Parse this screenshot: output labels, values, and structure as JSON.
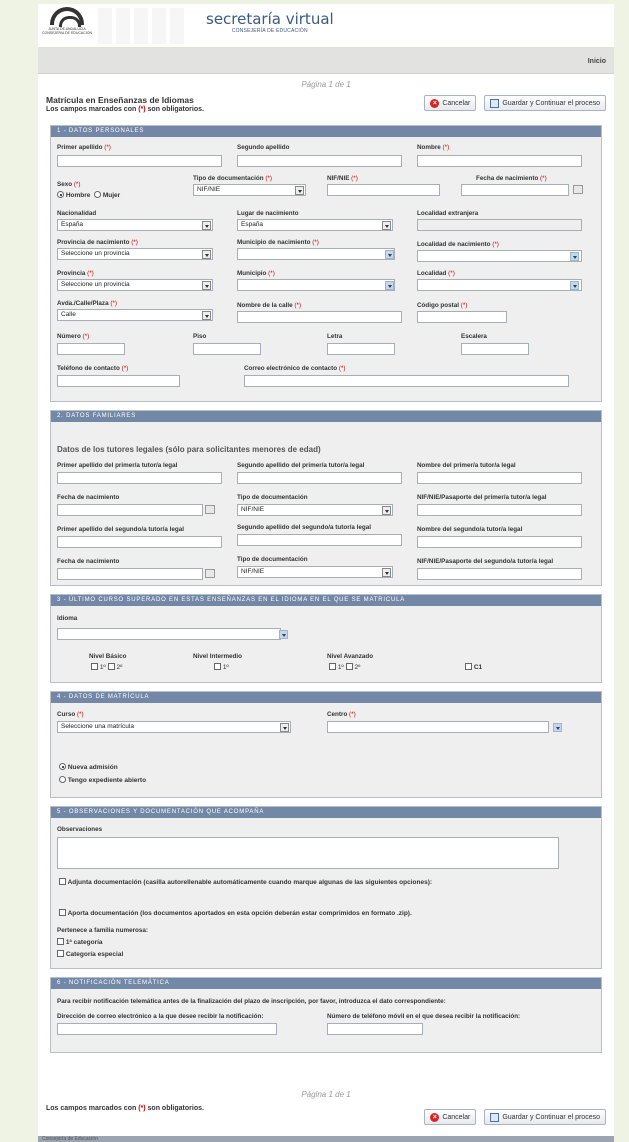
{
  "header": {
    "logo_text": "JUNTA DE ANDALUCIA CONSEJERIA DE EDUCACION",
    "title": "secretaría virtual",
    "subtitle": "CONSEJERÍA DE EDUCACIÓN",
    "inicio": "Inicio"
  },
  "page_indicator": "Página 1 de 1",
  "form": {
    "title": "Matrícula en Enseñanzas de Idiomas",
    "required_note_pre": "Los campos marcados con ",
    "required_star": "(*)",
    "required_note_post": " son obligatorios.",
    "cancel": "Cancelar",
    "save": "Guardar y Continuar el proceso"
  },
  "s1": {
    "title": "1 - DATOS PERSONALES",
    "primer_apellido": "Primer apellido",
    "segundo_apellido": "Segundo apellido",
    "nombre": "Nombre",
    "sexo": "Sexo",
    "hombre": "Hombre",
    "mujer": "Mujer",
    "tipo_doc": "Tipo de documentación",
    "tipo_doc_value": "NIF/NIE",
    "nif": "NIF/NIE",
    "fecha_nac": "Fecha de nacimiento",
    "nacionalidad": "Nacionalidad",
    "nacionalidad_value": "España",
    "lugar_nac": "Lugar de nacimiento",
    "lugar_nac_value": "España",
    "localidad_ext": "Localidad extranjera",
    "prov_nac": "Provincia de nacimiento",
    "prov_nac_value": "Seleccione un provincia",
    "mun_nac": "Municipio de nacimiento",
    "loc_nac": "Localidad de nacimiento",
    "provincia": "Provincia",
    "provincia_value": "Seleccione un provincia",
    "municipio": "Municipio",
    "localidad": "Localidad",
    "via": "Avda./Calle/Plaza",
    "via_value": "Calle",
    "nombre_calle": "Nombre de la calle",
    "cp": "Código postal",
    "numero": "Número",
    "piso": "Piso",
    "letra": "Letra",
    "escalera": "Escalera",
    "telefono": "Teléfono de contacto",
    "correo": "Correo electrónico de contacto",
    "star": "(*)"
  },
  "s2": {
    "title": "2. DATOS FAMILIARES",
    "subtitle": "Datos de los tutores legales (sólo para solicitantes menores de edad)",
    "ape1_t1": "Primer apellido del primer/a tutor/a legal",
    "ape2_t1": "Segundo apellido del primer/a tutor/a legal",
    "nom_t1": "Nombre del primer/a tutor/a legal",
    "fecha1": "Fecha de nacimiento",
    "tipo1": "Tipo de documentación",
    "tipo1_value": "NIF/NIE",
    "doc_t1": "NIF/NIE/Pasaporte del primer/a tutor/a legal",
    "ape1_t2": "Primer apellido del segundo/a tutor/a legal",
    "ape2_t2": "Segundo apellido del segundo/a tutor/a legal",
    "nom_t2": "Nombre del segundo/a tutor/a legal",
    "fecha2": "Fecha de nacimiento",
    "tipo2": "Tipo de documentación",
    "tipo2_value": "NIF/NIE",
    "doc_t2": "NIF/NIE/Pasaporte del segundo/a tutor/a legal"
  },
  "s3": {
    "title": "3 - ÚLTIMO CURSO SUPERADO EN ESTAS ENSEÑANZAS EN EL IDIOMA EN EL QUE SE MATRICULA",
    "idioma": "Idioma",
    "basico": "Nivel Básico",
    "intermedio": "Nivel Intermedio",
    "avanzado": "Nivel Avanzado",
    "o1": "1º",
    "o2": "2º",
    "c1": "C1"
  },
  "s4": {
    "title": "4 - DATOS DE MATRÍCULA",
    "curso": "Curso",
    "curso_value": "Seleccione una matrícula",
    "centro": "Centro",
    "nueva": "Nueva admisión",
    "expediente": "Tengo expediente abierto"
  },
  "s5": {
    "title": "5 - OBSERVACIONES Y DOCUMENTACIÓN QUE ACOMPAÑA",
    "observaciones": "Observaciones",
    "adjunta": "Adjunta documentación (casilla autorellenable automáticamente cuando marque algunas de las siguientes opciones):",
    "aporta": "Aporta documentación (los documentos aportados en esta opción deberán estar comprimidos en formato .zip).",
    "familia": "Pertenece a familia numerosa:",
    "cat1": "1ª categoría",
    "catesp": "Categoría especial"
  },
  "s6": {
    "title": "6 - NOTIFICACIÓN TELEMÁTICA",
    "intro": "Para recibir notificación telemática antes de la finalización del plazo de inscripción, por favor, introduzca el dato correspondiente:",
    "email": "Dirección de correo electrónico a la que desee recibir la notificación:",
    "movil": "Número de teléfono móvil en el que desea recibir la notificación:"
  },
  "footer": {
    "consejeria": "Consejería de Educación"
  }
}
